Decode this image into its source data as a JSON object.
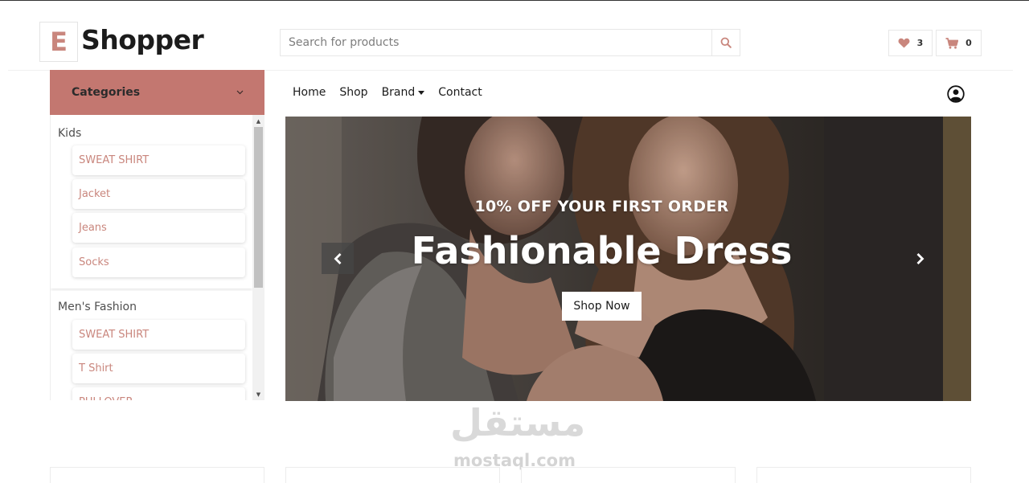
{
  "brand": {
    "letter": "E",
    "name": "Shopper",
    "accent": "#c9867d"
  },
  "search": {
    "placeholder": "Search for products",
    "icon": "search-icon"
  },
  "header": {
    "wishlist_count": "3",
    "cart_count": "0"
  },
  "categories": {
    "label": "Categories",
    "header_color": "#c37770",
    "groups": [
      {
        "title": "Kids",
        "items": [
          "SWEAT SHIRT",
          "Jacket",
          "Jeans",
          "Socks"
        ]
      },
      {
        "title": "Men's Fashion",
        "items": [
          "SWEAT SHIRT",
          "T Shirt",
          "PULLOVER"
        ]
      }
    ]
  },
  "nav": {
    "items": [
      "Home",
      "Shop",
      "Brand",
      "Contact"
    ]
  },
  "hero": {
    "subtitle": "10% OFF YOUR FIRST ORDER",
    "title": "Fashionable Dress",
    "cta": "Shop Now"
  },
  "watermark": {
    "arabic": "مستقل",
    "latin": "mostaql.com"
  }
}
